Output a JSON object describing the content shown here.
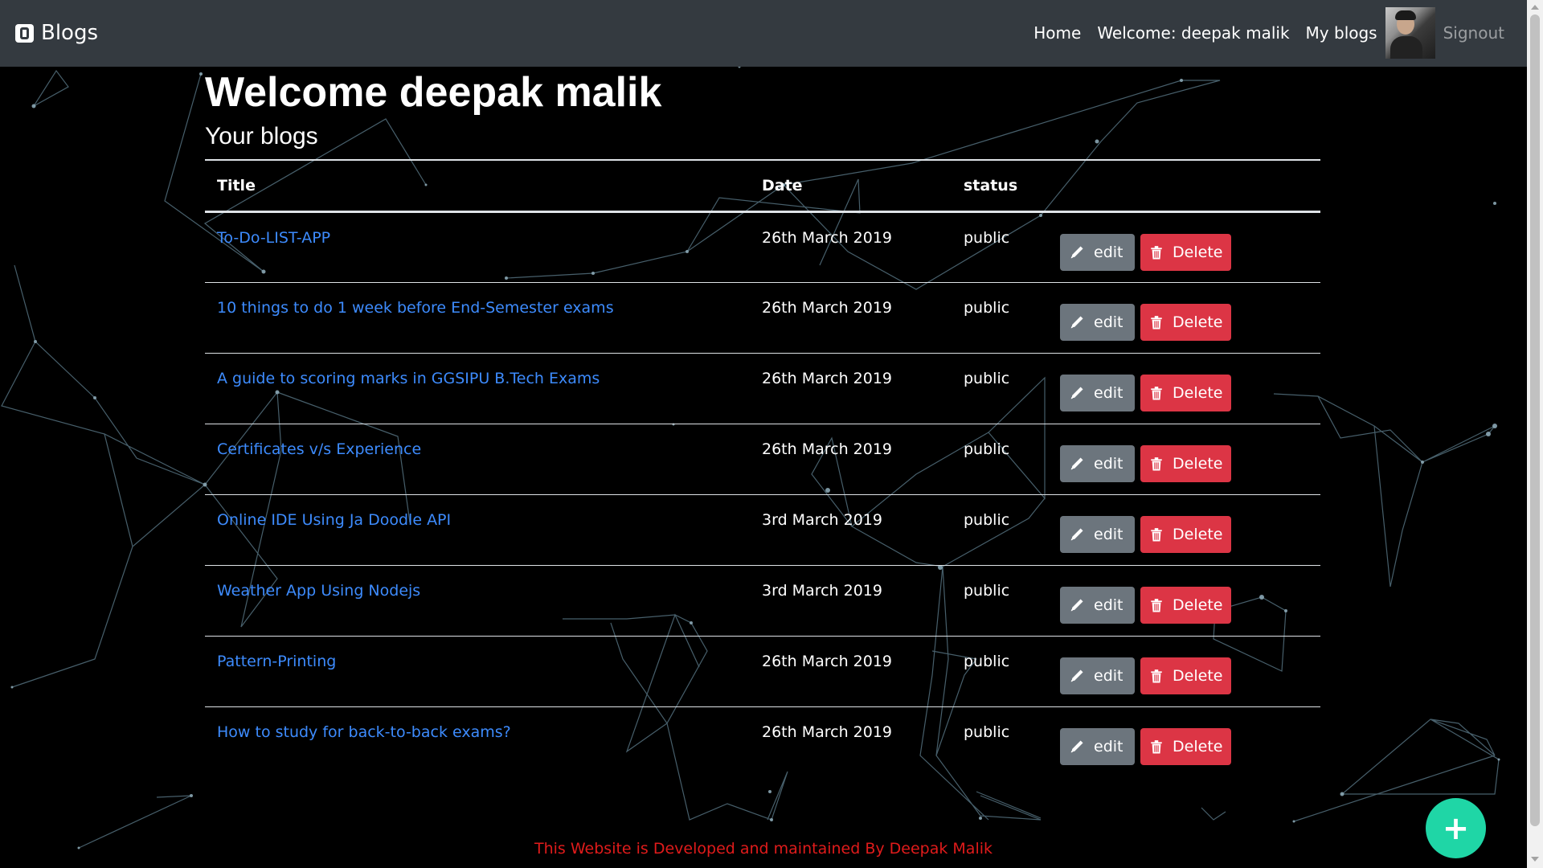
{
  "nav": {
    "brand": "Blogs",
    "home": "Home",
    "welcome": "Welcome: deepak malik",
    "my_blogs": "My blogs",
    "signout": "Signout"
  },
  "page": {
    "heading": "Welcome deepak malik",
    "subheading": "Your blogs"
  },
  "table": {
    "headers": [
      "Title",
      "Date",
      "status"
    ],
    "edit_label": "edit",
    "delete_label": "Delete",
    "rows": [
      {
        "title": "To-Do-LIST-APP",
        "date": "26th March 2019",
        "status": "public"
      },
      {
        "title": "10 things to do 1 week before End-Semester exams",
        "date": "26th March 2019",
        "status": "public"
      },
      {
        "title": "A guide to scoring marks in GGSIPU B.Tech Exams",
        "date": "26th March 2019",
        "status": "public"
      },
      {
        "title": "Certificates v/s Experience",
        "date": "26th March 2019",
        "status": "public"
      },
      {
        "title": "Online IDE Using Ja Doodle API",
        "date": "3rd March 2019",
        "status": "public"
      },
      {
        "title": "Weather App Using Nodejs",
        "date": "3rd March 2019",
        "status": "public"
      },
      {
        "title": "Pattern-Printing",
        "date": "26th March 2019",
        "status": "public"
      },
      {
        "title": "How to study for back-to-back exams?",
        "date": "26th March 2019",
        "status": "public"
      }
    ]
  },
  "footer": "This Website is Developed and maintained By Deepak Malik",
  "fab_label": "+",
  "colors": {
    "navbar": "#343a40",
    "link": "#3d8bfd",
    "edit_button": "#6c757d",
    "delete_button": "#dc3545",
    "fab": "#1fd6a6",
    "footer_text": "#e01b1b"
  },
  "icons": {
    "brand": "blogger-icon",
    "edit": "pencil-icon",
    "delete": "trash-icon",
    "fab": "plus-icon"
  }
}
